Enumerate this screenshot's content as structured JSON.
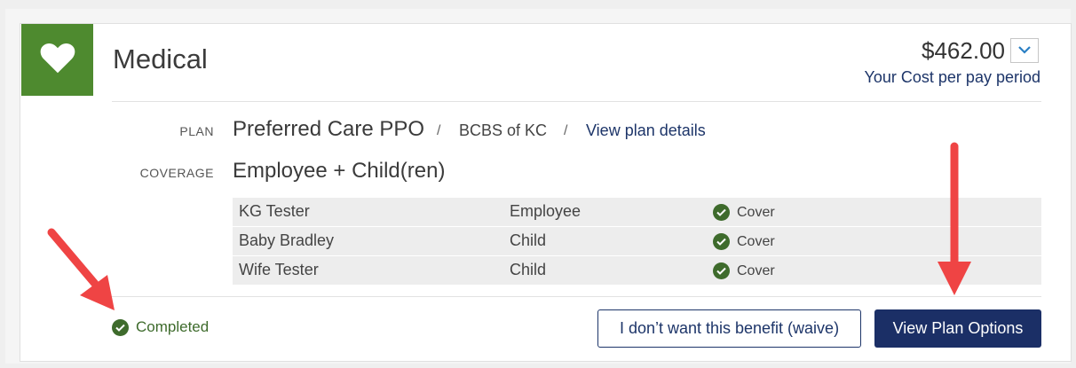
{
  "benefit": {
    "title": "Medical",
    "icon": "heart-icon",
    "accent_color": "#4e8a2f",
    "cost": "$462.00",
    "cost_label": "Your Cost per pay period"
  },
  "plan": {
    "label": "PLAN",
    "name": "Preferred Care PPO",
    "separator": "/",
    "carrier": "BCBS of KC",
    "details_link": "View plan details"
  },
  "coverage": {
    "label": "COVERAGE",
    "value": "Employee + Child(ren)"
  },
  "dependents": [
    {
      "name": "KG Tester",
      "relation": "Employee",
      "status": "Cover"
    },
    {
      "name": "Baby Bradley",
      "relation": "Child",
      "status": "Cover"
    },
    {
      "name": "Wife Tester",
      "relation": "Child",
      "status": "Cover"
    }
  ],
  "footer": {
    "status": "Completed",
    "waive_label": "I don’t want this benefit (waive)",
    "view_label": "View Plan Options"
  },
  "annotations": {
    "arrow_color": "#ef4444"
  }
}
